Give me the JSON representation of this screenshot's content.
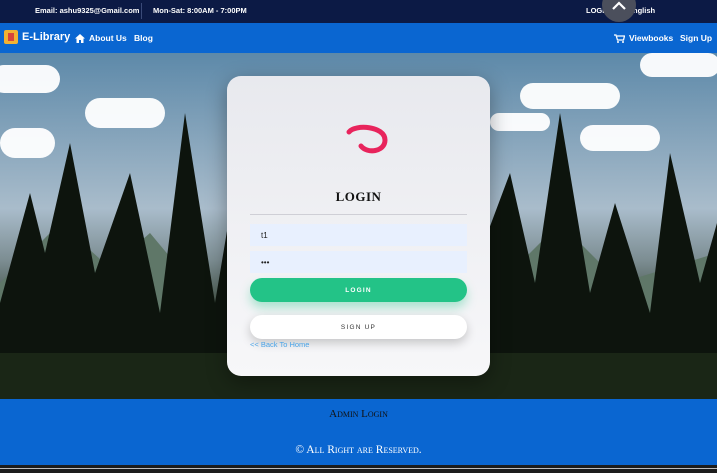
{
  "topbar": {
    "email": "Email: ashu9325@Gmail.com",
    "hours": "Mon-Sat: 8:00AM - 7:00PM",
    "login": "LOGIN",
    "language": "English"
  },
  "navbar": {
    "brand": "E-Library",
    "about": "About Us",
    "blog": "Blog",
    "viewbooks": "Viewbooks",
    "signup": "Sign Up"
  },
  "login_card": {
    "title": "LOGIN",
    "username_value": "t1",
    "password_value": "•••",
    "login_button": "LOGIN",
    "signup_button": "SIGN UP",
    "back_link": "<< Back To Home",
    "logo_color": "#e8245c"
  },
  "footer": {
    "admin_login": "Admin Login",
    "copyright": "© All Right are Reserved."
  },
  "colors": {
    "navbar": "#0a66d1",
    "topbar": "#0c1a45",
    "accent_green": "#23c387"
  }
}
